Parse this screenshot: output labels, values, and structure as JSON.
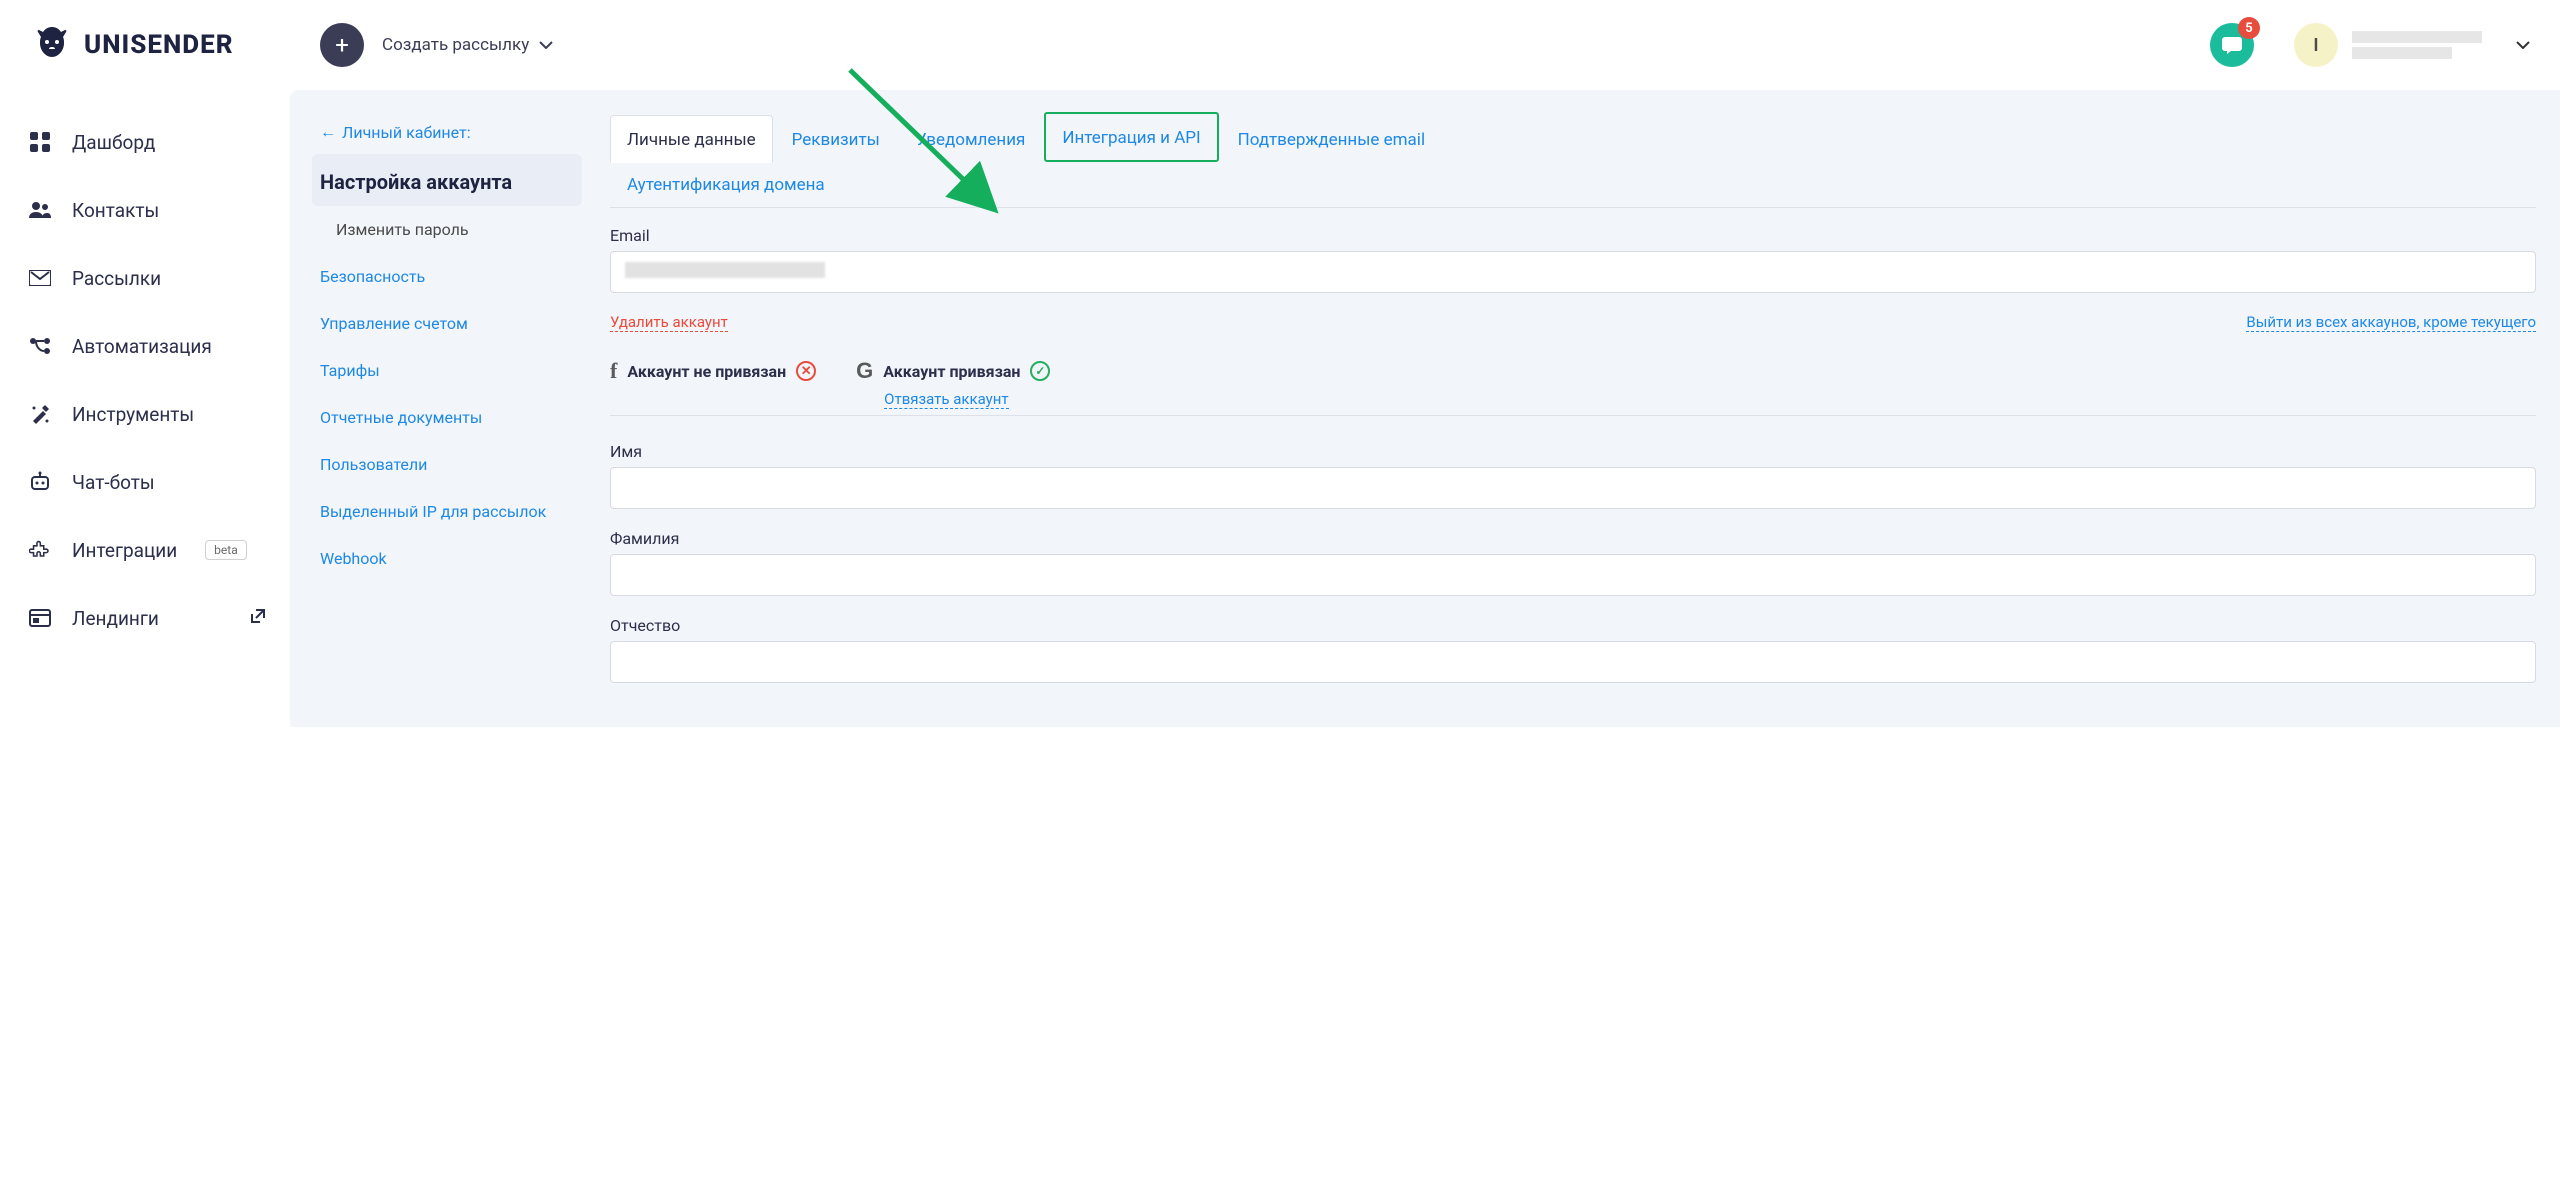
{
  "header": {
    "brand": "UNISENDER",
    "create_label": "Создать рассылку",
    "chat_badge": "5",
    "avatar_initial": "I"
  },
  "sidebar": {
    "items": [
      {
        "label": "Дашборд",
        "icon": "dashboard"
      },
      {
        "label": "Контакты",
        "icon": "contacts"
      },
      {
        "label": "Рассылки",
        "icon": "mail"
      },
      {
        "label": "Автоматизация",
        "icon": "automation"
      },
      {
        "label": "Инструменты",
        "icon": "tools"
      },
      {
        "label": "Чат-боты",
        "icon": "chatbots"
      },
      {
        "label": "Интеграции",
        "icon": "integrations",
        "badge": "beta"
      },
      {
        "label": "Лендинги",
        "icon": "landings",
        "external": true
      }
    ]
  },
  "subnav": {
    "back": "Личный кабинет:",
    "title": "Настройка аккаунта",
    "items": [
      {
        "label": "Изменить пароль",
        "muted": true
      },
      {
        "label": "Безопасность"
      },
      {
        "label": "Управление счетом"
      },
      {
        "label": "Тарифы"
      },
      {
        "label": "Отчетные документы"
      },
      {
        "label": "Пользователи"
      },
      {
        "label": "Выделенный IP для рассылок"
      },
      {
        "label": "Webhook"
      }
    ]
  },
  "tabs": [
    {
      "label": "Личные данные",
      "active": true
    },
    {
      "label": "Реквизиты"
    },
    {
      "label": "Уведомления"
    },
    {
      "label": "Интеграция и API",
      "highlighted": true
    },
    {
      "label": "Подтвержденные email"
    },
    {
      "label": "Аутентификация домена"
    }
  ],
  "form": {
    "email_label": "Email",
    "delete_account": "Удалить аккаунт",
    "logout_others": "Выйти из всех аккаунов, кроме текущего",
    "social": {
      "fb_letter": "f",
      "fb_title": "Аккаунт не привязан",
      "g_letter": "G",
      "g_title": "Аккаунт привязан",
      "g_unlink": "Отвязать аккаунт"
    },
    "name_label": "Имя",
    "surname_label": "Фамилия",
    "patronymic_label": "Отчество"
  }
}
